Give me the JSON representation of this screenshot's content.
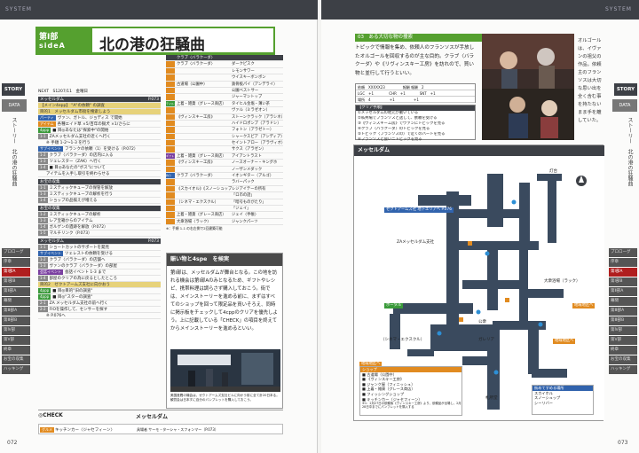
{
  "left": {
    "header_label": "SYSTEM",
    "chapter": {
      "line1": "第Ⅰ部",
      "line2": "sideA"
    },
    "title": "北の港の狂騒曲",
    "story_tab": "STORY",
    "data_tab": "DATA",
    "vertical_tab": "ストーリー　北の港の狂騒曲",
    "nav": [
      "プロローグ",
      "序章",
      "第Ⅰ部A",
      "第Ⅰ部B",
      "第Ⅱ部A",
      "幕間",
      "第Ⅲ部A",
      "第Ⅲ部B",
      "第Ⅳ部",
      "第Ⅴ部",
      "終章",
      "お宝の収集",
      "ハッキング"
    ],
    "nav_active": 2,
    "page_number": "072",
    "rows": [
      {
        "kind": "plain",
        "text": "NEXT　S1207/11　金曜日"
      },
      {
        "kind": "sec",
        "text": "メッセルダム",
        "right": "P.073"
      },
      {
        "kind": "sub",
        "text": "【メイン4epp】 \"A\"の依頼\" の調査"
      },
      {
        "kind": "sub",
        "text": "目的1　メッセルダム市街を捜索しよう"
      },
      {
        "kind": "tag",
        "tag": "パーティ",
        "color": "t-blue",
        "text": "ヴァン、ガトル、ジョディス で開始"
      },
      {
        "kind": "tag",
        "tag": "アイテム",
        "color": "t-orange",
        "text": "各種エイド草 ×5/百年の猟犬 ×1/さらに"
      },
      {
        "kind": "tag",
        "tag": "4ppp",
        "color": "t-green",
        "text": "■ 目◎あなたは\"探索中\"の開始"
      },
      {
        "kind": "tag",
        "tag": "1-1",
        "color": "t-gray",
        "text": "ZAメッセルダム支社の近くへ行く"
      },
      {
        "kind": "plain",
        "text": "　　※ 手順 1-2～1-3 を行う"
      },
      {
        "kind": "tag",
        "tag": "サブイベント",
        "color": "t-blue",
        "text": "フランクの依頼（1）を受ける（P.072）"
      },
      {
        "kind": "tag",
        "tag": "1-2",
        "color": "t-gray",
        "text": "クラブ〈バラクーダ〉の店内に入る"
      },
      {
        "kind": "tag",
        "tag": "1-3",
        "color": "t-gray",
        "text": "ツェレスター〈ZAK〉へ行く"
      },
      {
        "kind": "tag",
        "tag": "1-4",
        "color": "t-gray",
        "text": "■ 目◎あなたの\"ボス\"について"
      },
      {
        "kind": "plain",
        "text": "　　アイテムを入手し取引を終わらせる"
      },
      {
        "kind": "sec",
        "text": "お宝の収集",
        "right": ""
      },
      {
        "kind": "tag",
        "tag": "1-1",
        "color": "t-gray",
        "text": "ミスティックキューブの保管を解放"
      },
      {
        "kind": "tag",
        "tag": "1-3",
        "color": "t-gray",
        "text": "ミスティックキューブの解析を行う"
      },
      {
        "kind": "tag",
        "tag": "1-4",
        "color": "t-gray",
        "text": "ショップの品揃えが増える"
      },
      {
        "kind": "sec",
        "text": "お宝の収集",
        "right": ""
      },
      {
        "kind": "tag",
        "tag": "1-2",
        "color": "t-gray",
        "text": "ミスティックキューブの解析"
      },
      {
        "kind": "tag",
        "tag": "1-3",
        "color": "t-gray",
        "text": "レア宝箱からのアイテム"
      },
      {
        "kind": "tag",
        "tag": "1-4",
        "color": "t-gray",
        "text": "ガルゲンの遺跡を解放（P.072）"
      },
      {
        "kind": "tag",
        "tag": "1-5",
        "color": "t-gray",
        "text": "マルチリンク（P.073）"
      },
      {
        "kind": "sec",
        "text": "メッセルダム",
        "right": "P.073"
      },
      {
        "kind": "tag",
        "tag": "1-1",
        "color": "t-gray",
        "text": "ショートカットのサポートを発見"
      },
      {
        "kind": "tag",
        "tag": "サブイベント",
        "color": "t-blue",
        "text": "ツェレストの依頼を受ける"
      },
      {
        "kind": "tag",
        "tag": "1-2",
        "color": "t-gray",
        "text": "クラブ〈バラクーダ〉の店舗へ"
      },
      {
        "kind": "tag",
        "tag": "1-3",
        "color": "t-gray",
        "text": "ヴァンのクラブ〈バラクーダ〉の部屋"
      },
      {
        "kind": "tag",
        "tag": "会話イベント",
        "color": "t-purple",
        "text": "会話イベント 1-3 まで"
      },
      {
        "kind": "tag",
        "tag": "1-4",
        "color": "t-gray",
        "text": "部屋のクリアの為に戻るとしたところ"
      },
      {
        "kind": "sub",
        "text": "目的2　ゼクトアームズ支社に向かおう"
      },
      {
        "kind": "tag",
        "tag": "4ppp",
        "color": "t-green",
        "text": "■ 目◎目的\"旧の調査\""
      },
      {
        "kind": "tag",
        "tag": "4ppp",
        "color": "t-green",
        "text": "■ 目◎\"スターの調査\""
      },
      {
        "kind": "tag",
        "tag": "2-1",
        "color": "t-gray",
        "text": "ZA メッセルダム支社の前へ行く"
      },
      {
        "kind": "tag",
        "tag": "2-2",
        "color": "t-gray",
        "text": "FIOを操作して、センサーを探す"
      },
      {
        "kind": "plain",
        "text": "　　※ P.076へ"
      }
    ],
    "group": {
      "head": "クラブ〈バラクーダ〉",
      "rows": [
        {
          "side": "",
          "text": "クラブ〈バラクーダ〉",
          "right": "ダークピスク"
        },
        {
          "side": "",
          "text": "",
          "right": "レモンサワー"
        },
        {
          "side": "",
          "text": "",
          "right": "ウイスキーボンボン"
        },
        {
          "side": "",
          "text": "古道場（公園中）",
          "right": "鉄骨板パイ（アンデライ）"
        },
        {
          "side": "",
          "text": "",
          "right": "公園ベストサー"
        },
        {
          "side": "",
          "text": "",
          "right": "ジャーマントップ"
        },
        {
          "side": "テイルス",
          "text": "上着・雑貨（グレース商店）",
          "right": "タイヒル金塩・薄い茶"
        },
        {
          "side": "",
          "text": "",
          "right": "ヴァル（ミラゼオン）"
        },
        {
          "side": "",
          "text": "《ヴィンスキー工房》",
          "right": "ストーンクラック（アラシネ）"
        },
        {
          "side": "",
          "text": "",
          "right": "ハイドロポンプ（アラドシ）"
        },
        {
          "side": "",
          "text": "",
          "right": "フォトン（アラゼトー）"
        },
        {
          "side": "",
          "text": "",
          "right": "シャークスピア（アンディア）"
        },
        {
          "side": "",
          "text": "",
          "right": "セイントアロー（アラヴィオ）"
        },
        {
          "side": "",
          "text": "",
          "right": "サクス（アラゼン）"
        },
        {
          "side": "ギフト",
          "text": "上着・雑貨（グレース商店）",
          "right": "アイアントラスト"
        },
        {
          "side": "",
          "text": "《ヴィンスキー工房》",
          "right": "ノースオーナー・キングホ"
        },
        {
          "side": "",
          "text": "",
          "right": "ノーザンメダック"
        },
        {
          "side": "釣り",
          "text": "クラブ〈バラクーダ〉",
          "right": "イオンギター（アルゴ）"
        },
        {
          "side": "",
          "text": "",
          "right": "ラバーパック"
        },
        {
          "side": "",
          "text": "《スカイオル》《スノーシュップ》",
          "right": "レジアイテーの所有"
        },
        {
          "side": "",
          "text": "",
          "right": "「ロ市の話」"
        },
        {
          "side": "",
          "text": "（シネマ・エクスクル）",
          "right": "「暗号ものがたり」"
        },
        {
          "side": "",
          "text": "",
          "right": "「ジェイ」"
        },
        {
          "side": "",
          "text": "上着・雑貨（グレース商店）",
          "right": "ジェイ〈手帳〉"
        },
        {
          "side": "",
          "text": "大衆浴場〈ラック〉",
          "right": "ジャンクパーツ"
        }
      ],
      "footnote": "※：手順 1-1 の右左側で2回建築可能"
    },
    "essay": {
      "heading": "賑い物と4spe　を候実",
      "body": "第Ⅰ部は、メッセルダムが舞台となる。この地を訪れる機会は第Ⅰ部Aのみとなるため、ギフトやレシピ、携帯料理は調らさず購入しておこう。街では、メインストーリーを進める前に、まずはすべてのショップを回って限定品を買いそろえ、同時に掲示板をチェックして4cppのクリアを優先しよう。上に記載している「CHECK」の項目を終えてからメインストーリーを進めるといい。",
      "photo_caption": "美国産贋の機会は、ゼクトアームズ支社ビルに向かう前に全て計20日本る。観賞会は日本すに自分のパンプレットを購入しておこう。"
    },
    "check": {
      "label": "◎CHECK",
      "place": "メッセルダム",
      "row_tag": "グルメ",
      "row_text": "キッチンカー〈ジャセフィーン〉",
      "row_right": "具場者 サーモ・ターシャ・スフォンマー（P.073）"
    }
  },
  "right": {
    "header_label": "SYSTEM",
    "story_tab": "STORY",
    "data_tab": "DATA",
    "vertical_tab": "ストーリー　北の港の狂騒曲",
    "nav": [
      "プロローグ",
      "序章",
      "第Ⅰ部A",
      "第Ⅰ部B",
      "第Ⅱ部A",
      "幕間",
      "第Ⅲ部A",
      "第Ⅲ部B",
      "第Ⅳ部",
      "第Ⅴ部",
      "終章",
      "お宝の収集",
      "ハッキング"
    ],
    "nav_active": 2,
    "page_number": "073",
    "section": "03　ある大切な物の捜索",
    "quest_text": "トピックで情報を集め、依頼人のフランソスが手放したオルゴールを回収するのが主な目的。クラブ〈バラクーダ〉や《リヴィンスキー工房》を訪れので、買い物と並行して行うといい。",
    "quest_table": [
      "依頼　XXXXX23　　　　　報酬 報酬　2",
      "LGC　+1　　　　 CHR　+1　　　　SNT　+1",
      "場所　4　　　　　 +1　　　　　 +1"
    ],
    "clear": {
      "head": "【クリア手順】",
      "steps": [
        "①メッセルダムの地元が動いている",
        "②私共場でフランソスと話して、依頼を受ける",
        "③《ヴィンスキー工房》でヴァンにトピックを見る",
        "④クラブ〈バラクーダ〉のトピックを見る",
        "⑤トピック〈フランソスの〉で近くのパートを見る",
        "⑥フランソスと会いニトピックを見る"
      ]
    },
    "caption": "オルゴールは、イヴァンの祖父の作品。依頼主のフランソスは大切な思い出を全く含む事を持たないまま手を離していた。",
    "map": {
      "title": "メッセルダム",
      "labels": [
        {
          "t": "ゼクトアームズ社 地下エリアへ P.076",
          "k": "tagb"
        },
        {
          "t": "ZAメッセルダム支社",
          "k": "lbl"
        },
        {
          "t": "ボータル",
          "k": "tagg"
        },
        {
          "t": "公衆",
          "k": "lbl"
        },
        {
          "t": "（シネマ・エクスクル）",
          "k": "lbl"
        },
        {
          "t": "ガレリア",
          "k": "lbl"
        },
        {
          "t": "大衆浴場（ラック）",
          "k": "lbl"
        },
        {
          "t": "地域地区へ",
          "k": "tago"
        },
        {
          "t": "地域地区へ",
          "k": "tago"
        },
        {
          "t": "地域地区へ",
          "k": "tago"
        },
        {
          "t": "札所堂",
          "k": "lbl"
        },
        {
          "t": "灯台",
          "k": "lbl"
        }
      ],
      "legend": {
        "head": "ショップ",
        "items": [
          "■ 古道場（公園中）",
          "■ 《ヴィンスキー工房》",
          "■ ジャンク屋（フィニッシュ）",
          "■ 上着・雑貨（グレース商店）",
          "■ フィッシングショップ",
          "■ キッチンカー〈ジャセフィーン〉"
        ],
        "note": "※1：2月27日の依頼後《ヴィンスキー工房》より、依頼品が出場し、2月28日中までにパンフレットを購入する"
      },
      "legend2": {
        "head": "街めてすめる場所",
        "items": [
          "スカイホル",
          "スノーシュップ",
          "シーリバー"
        ]
      }
    }
  }
}
